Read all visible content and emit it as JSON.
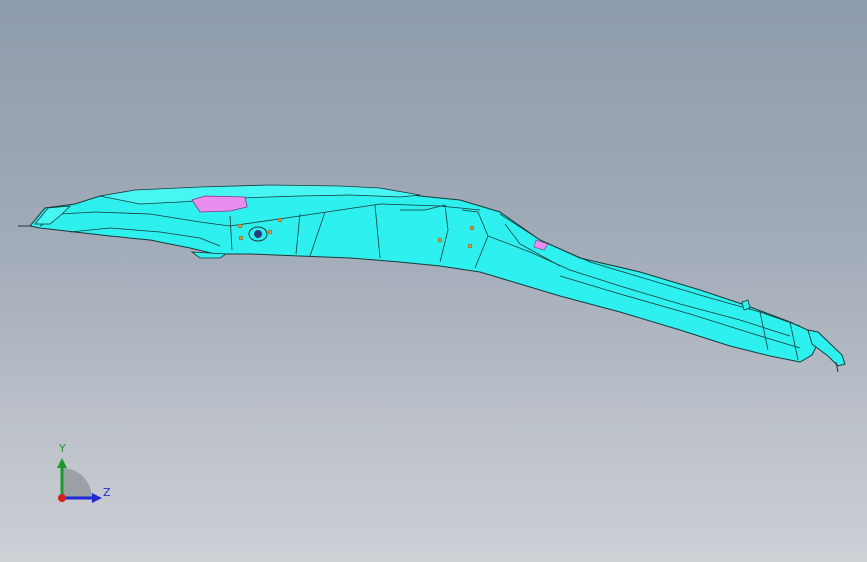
{
  "viewport": {
    "background_top": "#8e9bac",
    "background_bottom": "#cdd0d5"
  },
  "model": {
    "part_color": "#2ef1ef",
    "edge_color": "#1a3a3a",
    "highlight_color": "#e98ef0",
    "hole_color": "#d9a037"
  },
  "triad": {
    "y_label": "Y",
    "z_label": "Z",
    "y_color": "#1d9a2a",
    "z_color": "#1f2bd0",
    "origin_color": "#d42020"
  }
}
